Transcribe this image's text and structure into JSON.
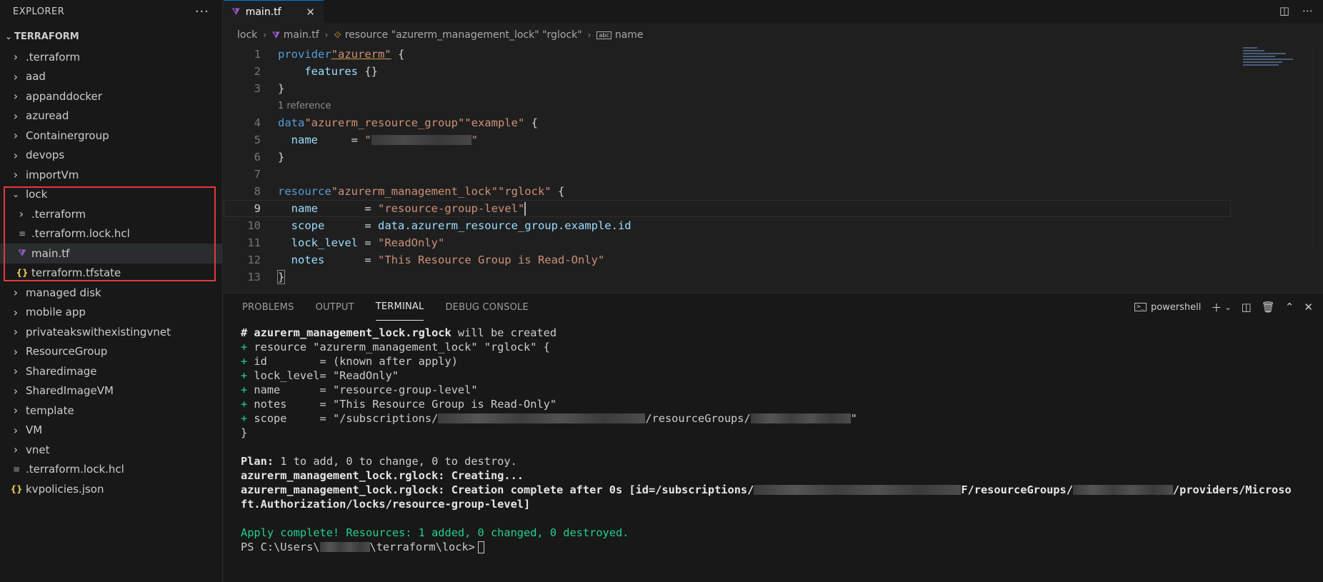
{
  "sidebar": {
    "title": "EXPLORER",
    "more_label": "···",
    "root": "TERRAFORM",
    "items": [
      {
        "label": ".terraform",
        "type": "folder"
      },
      {
        "label": "aad",
        "type": "folder"
      },
      {
        "label": "appanddocker",
        "type": "folder"
      },
      {
        "label": "azuread",
        "type": "folder"
      },
      {
        "label": "Containergroup",
        "type": "folder"
      },
      {
        "label": "devops",
        "type": "folder"
      },
      {
        "label": "importVm",
        "type": "folder"
      },
      {
        "label": "lock",
        "type": "folder-open"
      },
      {
        "label": ".terraform",
        "type": "subfolder"
      },
      {
        "label": ".terraform.lock.hcl",
        "type": "subfile-lines"
      },
      {
        "label": "main.tf",
        "type": "subfile-tf"
      },
      {
        "label": "terraform.tfstate",
        "type": "subfile-json"
      },
      {
        "label": "managed disk",
        "type": "folder"
      },
      {
        "label": "mobile app",
        "type": "folder"
      },
      {
        "label": "privateakswithexistingvnet",
        "type": "folder"
      },
      {
        "label": "ResourceGroup",
        "type": "folder"
      },
      {
        "label": "Sharedimage",
        "type": "folder"
      },
      {
        "label": "SharedImageVM",
        "type": "folder"
      },
      {
        "label": "template",
        "type": "folder"
      },
      {
        "label": "VM",
        "type": "folder"
      },
      {
        "label": "vnet",
        "type": "folder"
      },
      {
        "label": ".terraform.lock.hcl",
        "type": "file-lines"
      },
      {
        "label": "kvpolicies.json",
        "type": "file-json"
      }
    ]
  },
  "editor": {
    "tab_label": "main.tf",
    "tab_close": "✕",
    "breadcrumb": {
      "folder": "lock",
      "file": "main.tf",
      "resource": "resource \"azurerm_management_lock\" \"rglock\"",
      "attr": "name"
    },
    "codelens": "1 reference",
    "line_numbers": [
      "1",
      "2",
      "3",
      "4",
      "5",
      "6",
      "7",
      "8",
      "9",
      "10",
      "11",
      "12",
      "13"
    ]
  },
  "panel": {
    "tabs": [
      "PROBLEMS",
      "OUTPUT",
      "TERMINAL",
      "DEBUG CONSOLE"
    ],
    "active_tab": "TERMINAL",
    "shell_label": "powershell",
    "terminal": {
      "l1_hash": "# ",
      "l1_bold": "azurerm_management_lock.rglock",
      "l1_rest": " will be created",
      "l2_plus": "+ ",
      "l2_rest": "resource \"azurerm_management_lock\" \"rglock\" {",
      "attrs": [
        {
          "key": "id        ",
          "val": "= (known after apply)"
        },
        {
          "key": "lock_level",
          "val": "= \"ReadOnly\""
        },
        {
          "key": "name      ",
          "val": "= \"resource-group-level\""
        },
        {
          "key": "notes     ",
          "val": "= \"This Resource Group is Read-Only\""
        }
      ],
      "scope_key": "scope     ",
      "scope_pre": "= \"/subscriptions/",
      "scope_mid": "/resourceGroups/",
      "scope_post": "\"",
      "close_brace": "}",
      "plan_label": "Plan:",
      "plan_rest": " 1 to add, 0 to change, 0 to destroy.",
      "creating": "azurerm_management_lock.rglock: Creating...",
      "complete_pre": "azurerm_management_lock.rglock: Creation complete after 0s [id=/subscriptions/",
      "complete_mid": "F/resourceGroups/",
      "complete_post": "/providers/Microso",
      "complete_wrap": "ft.Authorization/locks/resource-group-level]",
      "apply": "Apply complete! Resources: 1 added, 0 changed, 0 destroyed.",
      "prompt_pre": "PS C:\\Users\\",
      "prompt_post": "\\terraform\\lock>"
    }
  }
}
